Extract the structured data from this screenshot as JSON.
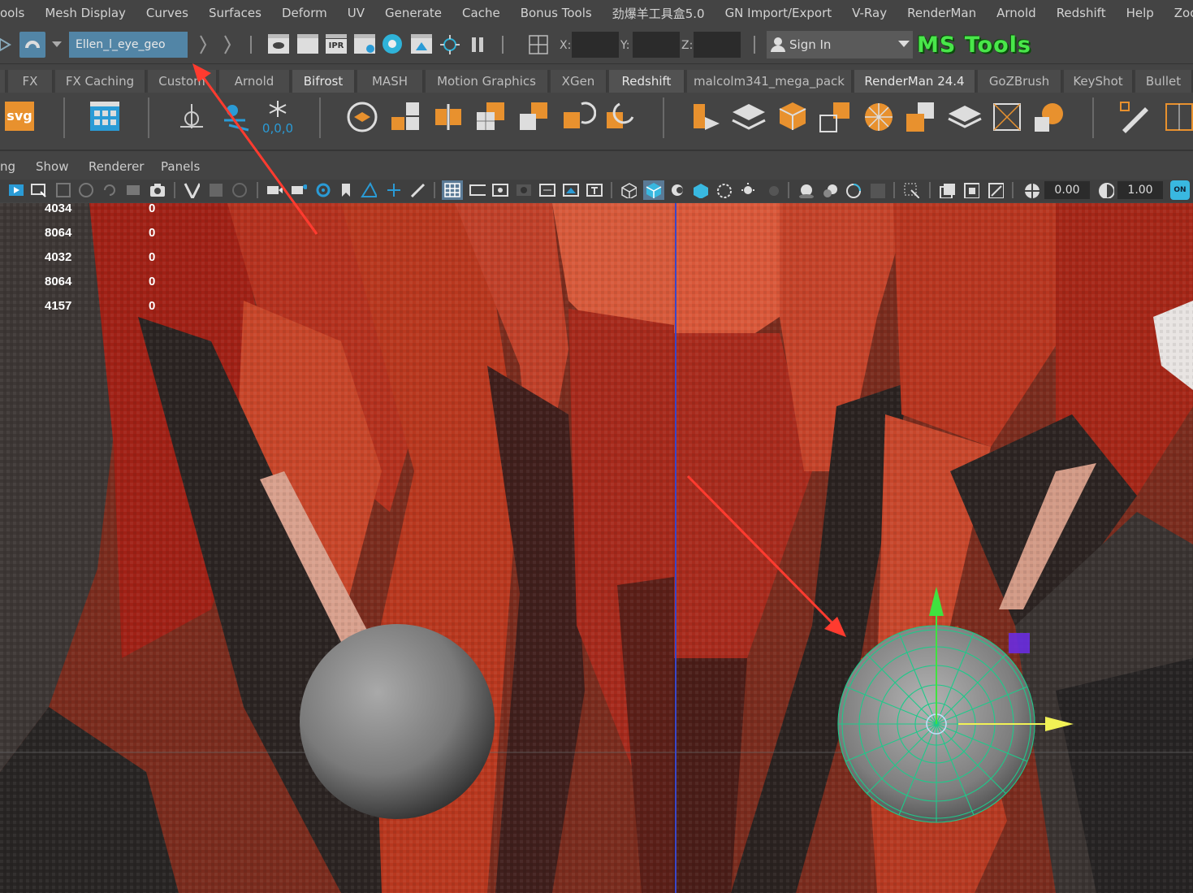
{
  "menu": [
    "ools",
    "Mesh Display",
    "Curves",
    "Surfaces",
    "Deform",
    "UV",
    "Generate",
    "Cache",
    "Bonus Tools",
    "劲爆羊工具盒5.0",
    "GN Import/Export",
    "V-Ray",
    "RenderMan",
    "Arnold",
    "Redshift",
    "Help",
    "Zoo Too"
  ],
  "status": {
    "selection_field": "Ellen_l_eye_geo",
    "ipr_label": "IPR",
    "x_label": "X:",
    "y_label": "Y:",
    "z_label": "Z:",
    "signin_label": "Sign In",
    "ms_tools_label": "MS Tools"
  },
  "shelf_tabs": [
    "FX",
    "FX Caching",
    "Custom",
    "Arnold",
    "Bifrost",
    "MASH",
    "Motion Graphics",
    "XGen",
    "Redshift",
    "malcolm341_mega_pack",
    "RenderMan 24.4",
    "GoZBrush",
    "KeyShot",
    "Bullet"
  ],
  "shelf": {
    "svg_label": "svg",
    "snowflake_label": "0,0,0"
  },
  "panel_menu": [
    "ng",
    "Show",
    "Renderer",
    "Panels"
  ],
  "panel_tools": {
    "value_a": "0.00",
    "value_b": "1.00",
    "on_label": "ON"
  },
  "hud_stats": [
    {
      "value": "4034",
      "value2": "0"
    },
    {
      "value": "8064",
      "value2": "0"
    },
    {
      "value": "4032",
      "value2": "0"
    },
    {
      "value": "8064",
      "value2": "0"
    },
    {
      "value": "4157",
      "value2": "0"
    }
  ],
  "colors": {
    "accent": "#5285a6",
    "annotation_arrow": "#ff3b2f",
    "ms_tools": "#49e64a",
    "selection_wire": "#1fc98a"
  },
  "icons": [
    "snap-icon",
    "magnet-icon",
    "render-view-icon",
    "ipr-render-icon",
    "hypershade-icon",
    "pause-icon",
    "sign-in-user-icon",
    "grid-icon",
    "camera-icon",
    "sphere-icon",
    "axis-icon"
  ]
}
